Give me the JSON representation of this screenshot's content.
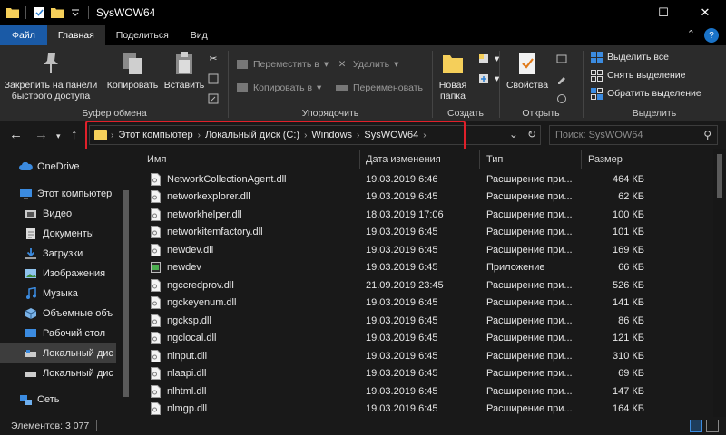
{
  "window": {
    "title": "SysWOW64",
    "minimize_glyph": "—",
    "maximize_glyph": "☐",
    "close_glyph": "✕"
  },
  "ribbon_tabs": [
    {
      "label": "Файл"
    },
    {
      "label": "Главная"
    },
    {
      "label": "Поделиться"
    },
    {
      "label": "Вид"
    }
  ],
  "ribbon": {
    "clipboard": {
      "pin_label": "Закрепить на панели быстрого доступа",
      "copy_label": "Копировать",
      "paste_label": "Вставить",
      "group_label": "Буфер обмена"
    },
    "organize": {
      "move_label": "Переместить в",
      "copy_to_label": "Копировать в",
      "delete_label": "Удалить",
      "rename_label": "Переименовать",
      "group_label": "Упорядочить"
    },
    "create": {
      "new_folder_label": "Новая папка",
      "group_label": "Создать"
    },
    "open": {
      "properties_label": "Свойства",
      "group_label": "Открыть"
    },
    "select": {
      "select_all_label": "Выделить все",
      "select_none_label": "Снять выделение",
      "invert_label": "Обратить выделение",
      "group_label": "Выделить"
    }
  },
  "address": {
    "crumbs": [
      "Этот компьютер",
      "Локальный диск (C:)",
      "Windows",
      "SysWOW64"
    ],
    "search_placeholder": "Поиск: SysWOW64"
  },
  "nav_pane": {
    "items": [
      {
        "label": "OneDrive",
        "icon": "cloud-icon"
      },
      {
        "label": "Этот компьютер",
        "icon": "computer-icon"
      },
      {
        "label": "Видео",
        "icon": "video-icon"
      },
      {
        "label": "Документы",
        "icon": "documents-icon"
      },
      {
        "label": "Загрузки",
        "icon": "download-icon"
      },
      {
        "label": "Изображения",
        "icon": "pictures-icon"
      },
      {
        "label": "Музыка",
        "icon": "music-icon"
      },
      {
        "label": "Объемные объ",
        "icon": "3d-objects-icon"
      },
      {
        "label": "Рабочий стол",
        "icon": "desktop-icon"
      },
      {
        "label": "Локальный дис",
        "icon": "drive-icon"
      },
      {
        "label": "Локальный дис",
        "icon": "drive-icon"
      },
      {
        "label": "Сеть",
        "icon": "network-icon"
      }
    ]
  },
  "file_list": {
    "columns": [
      "Имя",
      "Дата изменения",
      "Тип",
      "Размер"
    ],
    "rows": [
      {
        "name": "NetworkCollectionAgent.dll",
        "date": "19.03.2019 6:46",
        "type": "Расширение при...",
        "size": "464 КБ",
        "icon": "dll"
      },
      {
        "name": "networkexplorer.dll",
        "date": "19.03.2019 6:45",
        "type": "Расширение при...",
        "size": "62 КБ",
        "icon": "dll"
      },
      {
        "name": "networkhelper.dll",
        "date": "18.03.2019 17:06",
        "type": "Расширение при...",
        "size": "100 КБ",
        "icon": "dll"
      },
      {
        "name": "networkitemfactory.dll",
        "date": "19.03.2019 6:45",
        "type": "Расширение при...",
        "size": "101 КБ",
        "icon": "dll"
      },
      {
        "name": "newdev.dll",
        "date": "19.03.2019 6:45",
        "type": "Расширение при...",
        "size": "169 КБ",
        "icon": "dll"
      },
      {
        "name": "newdev",
        "date": "19.03.2019 6:45",
        "type": "Приложение",
        "size": "66 КБ",
        "icon": "exe"
      },
      {
        "name": "ngccredprov.dll",
        "date": "21.09.2019 23:45",
        "type": "Расширение при...",
        "size": "526 КБ",
        "icon": "dll"
      },
      {
        "name": "ngckeyenum.dll",
        "date": "19.03.2019 6:45",
        "type": "Расширение при...",
        "size": "141 КБ",
        "icon": "dll"
      },
      {
        "name": "ngcksp.dll",
        "date": "19.03.2019 6:45",
        "type": "Расширение при...",
        "size": "86 КБ",
        "icon": "dll"
      },
      {
        "name": "ngclocal.dll",
        "date": "19.03.2019 6:45",
        "type": "Расширение при...",
        "size": "121 КБ",
        "icon": "dll"
      },
      {
        "name": "ninput.dll",
        "date": "19.03.2019 6:45",
        "type": "Расширение при...",
        "size": "310 КБ",
        "icon": "dll"
      },
      {
        "name": "nlaapi.dll",
        "date": "19.03.2019 6:45",
        "type": "Расширение при...",
        "size": "69 КБ",
        "icon": "dll"
      },
      {
        "name": "nlhtml.dll",
        "date": "19.03.2019 6:45",
        "type": "Расширение при...",
        "size": "147 КБ",
        "icon": "dll"
      },
      {
        "name": "nlmgp.dll",
        "date": "19.03.2019 6:45",
        "type": "Расширение при...",
        "size": "164 КБ",
        "icon": "dll"
      }
    ]
  },
  "status": {
    "item_count": "Элементов: 3 077"
  },
  "colors": {
    "accent": "#1a5aa6",
    "highlight_border": "#e0202a",
    "folder": "#f5cf5a"
  }
}
